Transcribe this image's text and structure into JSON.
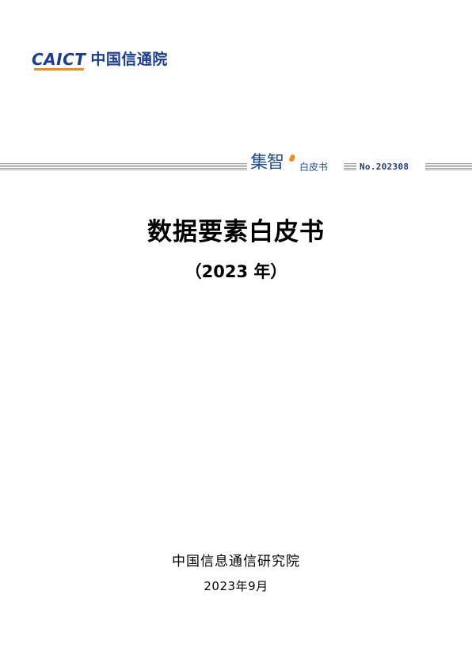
{
  "header": {
    "logo_mark": "CAICT",
    "logo_cn": "中国信通院"
  },
  "series": {
    "brand": "集智",
    "label": "白皮书",
    "number": "No.202308"
  },
  "cover": {
    "title": "数据要素白皮书",
    "subtitle": "（2023 年）"
  },
  "footer": {
    "organization": "中国信息通信研究院",
    "date": "2023年9月"
  },
  "colors": {
    "brand_blue": "#1a3d8f",
    "accent_orange": "#f08c1e",
    "stripe_gray": "#9aa1ad"
  }
}
